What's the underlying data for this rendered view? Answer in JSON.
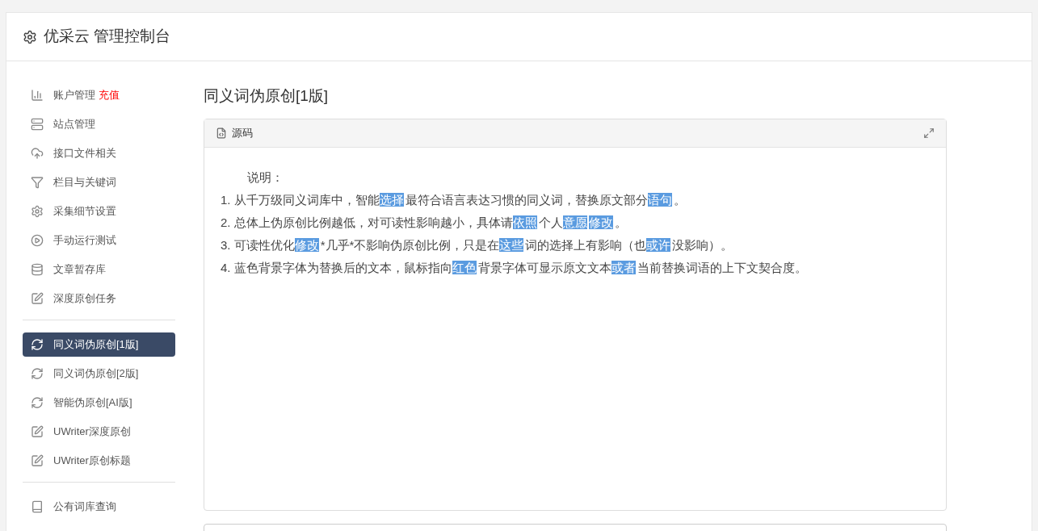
{
  "header": {
    "title": "优采云 管理控制台"
  },
  "sidebar": {
    "groups": [
      {
        "items": [
          {
            "kind": "chart",
            "label": "账户管理",
            "badge": "充值",
            "selected": false
          },
          {
            "kind": "server",
            "label": "站点管理",
            "selected": false
          },
          {
            "kind": "cloud",
            "label": "接口文件相关",
            "selected": false
          },
          {
            "kind": "filter",
            "label": "栏目与关键词",
            "selected": false
          },
          {
            "kind": "gears",
            "label": "采集细节设置",
            "selected": false
          },
          {
            "kind": "play",
            "label": "手动运行测试",
            "selected": false
          },
          {
            "kind": "database",
            "label": "文章暂存库",
            "selected": false
          },
          {
            "kind": "edit",
            "label": "深度原创任务",
            "selected": false
          }
        ]
      },
      {
        "items": [
          {
            "kind": "refresh",
            "label": "同义词伪原创[1版]",
            "selected": true
          },
          {
            "kind": "refresh",
            "label": "同义词伪原创[2版]",
            "selected": false
          },
          {
            "kind": "refresh",
            "label": "智能伪原创[AI版]",
            "selected": false
          },
          {
            "kind": "edit",
            "label": "UWriter深度原创",
            "selected": false
          },
          {
            "kind": "edit",
            "label": "UWriter原创标题",
            "selected": false
          }
        ]
      },
      {
        "items": [
          {
            "kind": "book",
            "label": "公有词库查询",
            "selected": false
          }
        ]
      }
    ]
  },
  "page_title": "同义词伪原创[1版]",
  "editor": {
    "toolbar_label": "源码",
    "heading": "说明：",
    "lines": [
      [
        {
          "text": "1. 从千万级同义词库中，智能",
          "highlighted": false
        },
        {
          "text": "选择",
          "highlighted": true
        },
        {
          "text": "最符合语言表达习惯的同义词，替换原文部分",
          "highlighted": false
        },
        {
          "text": "语句",
          "highlighted": true
        },
        {
          "text": "。",
          "highlighted": false
        }
      ],
      [
        {
          "text": "2. 总体上伪原创比例越低，对可读性影响越小，具体请",
          "highlighted": false
        },
        {
          "text": "依照",
          "highlighted": true
        },
        {
          "text": "个人",
          "highlighted": false
        },
        {
          "text": "意愿",
          "highlighted": true
        },
        {
          "text": "修改",
          "highlighted": true
        },
        {
          "text": "。",
          "highlighted": false
        }
      ],
      [
        {
          "text": "3. 可读性优化",
          "highlighted": false
        },
        {
          "text": "修改",
          "highlighted": true
        },
        {
          "text": "*几乎*不影响伪原创比例，只是在",
          "highlighted": false
        },
        {
          "text": "这些",
          "highlighted": true
        },
        {
          "text": "词的选择上有影响（也",
          "highlighted": false
        },
        {
          "text": "或许",
          "highlighted": true
        },
        {
          "text": "没影响）。",
          "highlighted": false
        }
      ],
      [
        {
          "text": "4. 蓝色背景字体为替换后的文本，鼠标指向",
          "highlighted": false
        },
        {
          "text": "红色",
          "highlighted": true
        },
        {
          "text": "背景字体可显示原文文本",
          "highlighted": false
        },
        {
          "text": "或者",
          "highlighted": true
        },
        {
          "text": "当前替换词语的上下文契合度。",
          "highlighted": false
        }
      ]
    ]
  }
}
